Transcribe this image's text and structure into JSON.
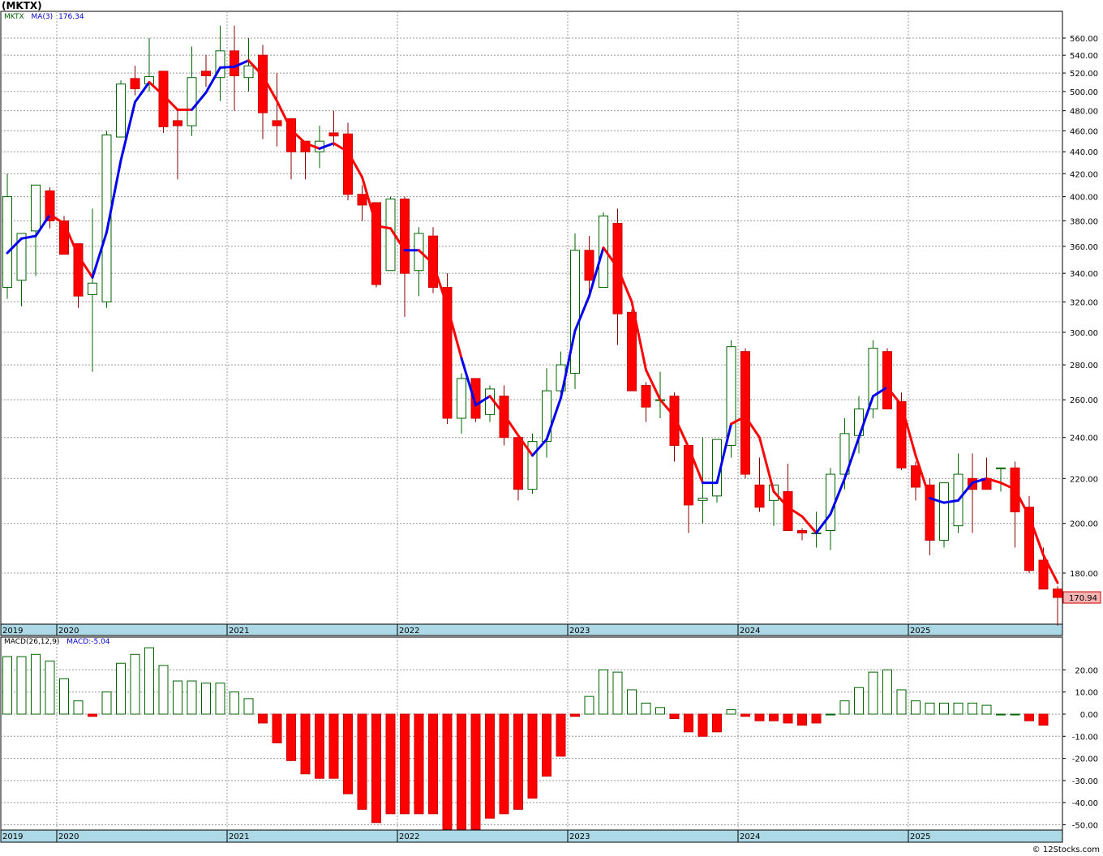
{
  "symbol": "(MKTX)",
  "copyright": "© 12Stocks.com",
  "price_legend": {
    "name": "MKTX",
    "ma_label": "MA(3)",
    "ma_value": "176.34"
  },
  "macd_legend": {
    "label": "MACD(26,12,9)",
    "value_label": "MACD:-5.04"
  },
  "colors": {
    "up": "#006400",
    "down": "#ff0000",
    "ma_up": "#0000ee",
    "ma_down": "#ff0000",
    "axis_band": "#add8e6",
    "grid": "#999999",
    "last_label_bg": "#f4b4b4"
  },
  "chart_data": [
    {
      "type": "candlestick",
      "scale": "log",
      "ylim": [
        160,
        580
      ],
      "y_ticks": [
        180,
        200,
        220,
        240,
        260,
        280,
        300,
        320,
        340,
        360,
        380,
        400,
        420,
        440,
        460,
        480,
        500,
        520,
        540,
        560
      ],
      "last_price_label": "170.94",
      "x_tick_labels": [
        "2019",
        "2020",
        "2021",
        "2022",
        "2023",
        "2024",
        "2025"
      ],
      "grid": true,
      "ohlc": [
        [
          330,
          420,
          322,
          400
        ],
        [
          335,
          370,
          317,
          370
        ],
        [
          372,
          410,
          338,
          410
        ],
        [
          405,
          408,
          374,
          380
        ],
        [
          380,
          384,
          360,
          354
        ],
        [
          362,
          362,
          316,
          324
        ],
        [
          325,
          390,
          276,
          333
        ],
        [
          320,
          460,
          316,
          456
        ],
        [
          454,
          512,
          454,
          508
        ],
        [
          514,
          528,
          496,
          503
        ],
        [
          508,
          560,
          500,
          516
        ],
        [
          522,
          522,
          458,
          464
        ],
        [
          470,
          480,
          415,
          465
        ],
        [
          465,
          550,
          455,
          515
        ],
        [
          522,
          540,
          505,
          517
        ],
        [
          515,
          575,
          490,
          545
        ],
        [
          545,
          575,
          480,
          517
        ],
        [
          515,
          560,
          500,
          528
        ],
        [
          540,
          552,
          452,
          478
        ],
        [
          470,
          520,
          445,
          465
        ],
        [
          472,
          472,
          415,
          440
        ],
        [
          450,
          445,
          415,
          440
        ],
        [
          440,
          465,
          425,
          450
        ],
        [
          458,
          480,
          445,
          455
        ],
        [
          457,
          468,
          397,
          402
        ],
        [
          402,
          410,
          380,
          393
        ],
        [
          395,
          390,
          330,
          332
        ],
        [
          342,
          400,
          345,
          398
        ],
        [
          398,
          400,
          310,
          340
        ],
        [
          342,
          375,
          324,
          370
        ],
        [
          368,
          375,
          326,
          330
        ],
        [
          330,
          340,
          247,
          250
        ],
        [
          250,
          275,
          242,
          272
        ],
        [
          272,
          270,
          248,
          250
        ],
        [
          252,
          268,
          248,
          266
        ],
        [
          262,
          268,
          236,
          240
        ],
        [
          240,
          240,
          210,
          215
        ],
        [
          215,
          242,
          213,
          238
        ],
        [
          238,
          278,
          230,
          265
        ],
        [
          265,
          288,
          262,
          280
        ],
        [
          275,
          370,
          266,
          357
        ],
        [
          357,
          368,
          325,
          335
        ],
        [
          330,
          387,
          330,
          384
        ],
        [
          378,
          390,
          292,
          312
        ],
        [
          313,
          315,
          265,
          265
        ],
        [
          268,
          270,
          248,
          256
        ],
        [
          260,
          276,
          250,
          260
        ],
        [
          262,
          264,
          228,
          236
        ],
        [
          236,
          230,
          196,
          208
        ],
        [
          210,
          240,
          200,
          211
        ],
        [
          212,
          238,
          209,
          239
        ],
        [
          236,
          295,
          230,
          291
        ],
        [
          288,
          290,
          220,
          222
        ],
        [
          217,
          230,
          205,
          207
        ],
        [
          210,
          215,
          199,
          217
        ],
        [
          214,
          227,
          198,
          197
        ],
        [
          197,
          198,
          193,
          196
        ],
        [
          196,
          205,
          190,
          196
        ],
        [
          197,
          225,
          189,
          222
        ],
        [
          222,
          250,
          215,
          242
        ],
        [
          241,
          262,
          232,
          255
        ],
        [
          255,
          295,
          250,
          290
        ],
        [
          288,
          290,
          255,
          255
        ],
        [
          259,
          264,
          224,
          225
        ],
        [
          226,
          228,
          210,
          216
        ],
        [
          217,
          220,
          187,
          193
        ],
        [
          193,
          217,
          190,
          218
        ],
        [
          199,
          232,
          196,
          222
        ],
        [
          220,
          232,
          196,
          215
        ],
        [
          220,
          230,
          216,
          215
        ],
        [
          225,
          225,
          214,
          225
        ],
        [
          225,
          228,
          190,
          205
        ],
        [
          207,
          212,
          180,
          181
        ],
        [
          185,
          190,
          175,
          174
        ],
        [
          174,
          175,
          161,
          170.94
        ]
      ],
      "ma": [
        [
          355,
          "up"
        ],
        [
          366,
          "up"
        ],
        [
          368,
          "up"
        ],
        [
          385,
          "up"
        ],
        [
          378,
          "down"
        ],
        [
          353,
          "down"
        ],
        [
          337,
          "down"
        ],
        [
          371,
          "up"
        ],
        [
          432,
          "up"
        ],
        [
          489,
          "up"
        ],
        [
          510,
          "up"
        ],
        [
          496,
          "down"
        ],
        [
          481,
          "down"
        ],
        [
          481,
          "down"
        ],
        [
          499,
          "up"
        ],
        [
          526,
          "up"
        ],
        [
          527,
          "up"
        ],
        [
          534,
          "up"
        ],
        [
          517,
          "down"
        ],
        [
          490,
          "down"
        ],
        [
          461,
          "down"
        ],
        [
          448,
          "down"
        ],
        [
          443,
          "down"
        ],
        [
          448,
          "up"
        ],
        [
          440,
          "down"
        ],
        [
          417,
          "down"
        ],
        [
          376,
          "down"
        ],
        [
          374,
          "down"
        ],
        [
          357,
          "down"
        ],
        [
          357,
          "up"
        ],
        [
          347,
          "down"
        ],
        [
          317,
          "down"
        ],
        [
          284,
          "down"
        ],
        [
          257,
          "up"
        ],
        [
          262,
          "up"
        ],
        [
          252,
          "down"
        ],
        [
          241,
          "down"
        ],
        [
          231,
          "down"
        ],
        [
          239,
          "up"
        ],
        [
          261,
          "up"
        ],
        [
          301,
          "up"
        ],
        [
          324,
          "up"
        ],
        [
          359,
          "up"
        ],
        [
          344,
          "down"
        ],
        [
          320,
          "down"
        ],
        [
          277,
          "down"
        ],
        [
          260,
          "down"
        ],
        [
          251,
          "down"
        ],
        [
          235,
          "down"
        ],
        [
          218,
          "down"
        ],
        [
          218,
          "up"
        ],
        [
          247,
          "up"
        ],
        [
          251,
          "down"
        ],
        [
          240,
          "down"
        ],
        [
          214,
          "down"
        ],
        [
          207,
          "down"
        ],
        [
          203,
          "down"
        ],
        [
          196,
          "down"
        ],
        [
          204,
          "up"
        ],
        [
          220,
          "up"
        ],
        [
          240,
          "up"
        ],
        [
          262,
          "up"
        ],
        [
          267,
          "up"
        ],
        [
          257,
          "down"
        ],
        [
          231,
          "down"
        ],
        [
          211,
          "down"
        ],
        [
          209,
          "up"
        ],
        [
          210,
          "up"
        ],
        [
          218,
          "up"
        ],
        [
          220,
          "up"
        ],
        [
          218,
          "down"
        ],
        [
          215,
          "down"
        ],
        [
          203,
          "down"
        ],
        [
          187,
          "down"
        ],
        [
          176.34,
          "down"
        ]
      ]
    },
    {
      "type": "bar",
      "name": "MACD(26,12,9)",
      "ylim": [
        -52,
        30
      ],
      "y_ticks": [
        20,
        10,
        0,
        -10,
        -20,
        -30,
        -40,
        -50
      ],
      "y_tick_labels": [
        "20.00",
        "10.00",
        "0.00",
        "-10.00",
        "-20.00",
        "-30.00",
        "-40.00",
        "-50.00"
      ],
      "x_tick_labels": [
        "2019",
        "2020",
        "2021",
        "2022",
        "2023",
        "2024",
        "2025"
      ],
      "values": [
        26,
        26,
        27,
        24,
        16,
        6,
        -1,
        10,
        23,
        27,
        30,
        22,
        15,
        15,
        14,
        14,
        10,
        7,
        -4,
        -13,
        -21,
        -27,
        -29,
        -29,
        -36,
        -43,
        -49,
        -45,
        -45,
        -45,
        -45,
        -52,
        -52,
        -52,
        -47,
        -45,
        -43,
        -38,
        -28,
        -19,
        -1,
        8,
        20,
        19,
        11,
        5,
        3,
        -2,
        -8,
        -10,
        -8,
        2,
        -1,
        -3,
        -3,
        -4,
        -5,
        -4,
        0,
        6,
        12,
        19,
        20,
        11,
        6,
        5,
        5,
        5,
        5,
        4,
        0,
        0,
        -3,
        -5
      ]
    }
  ]
}
